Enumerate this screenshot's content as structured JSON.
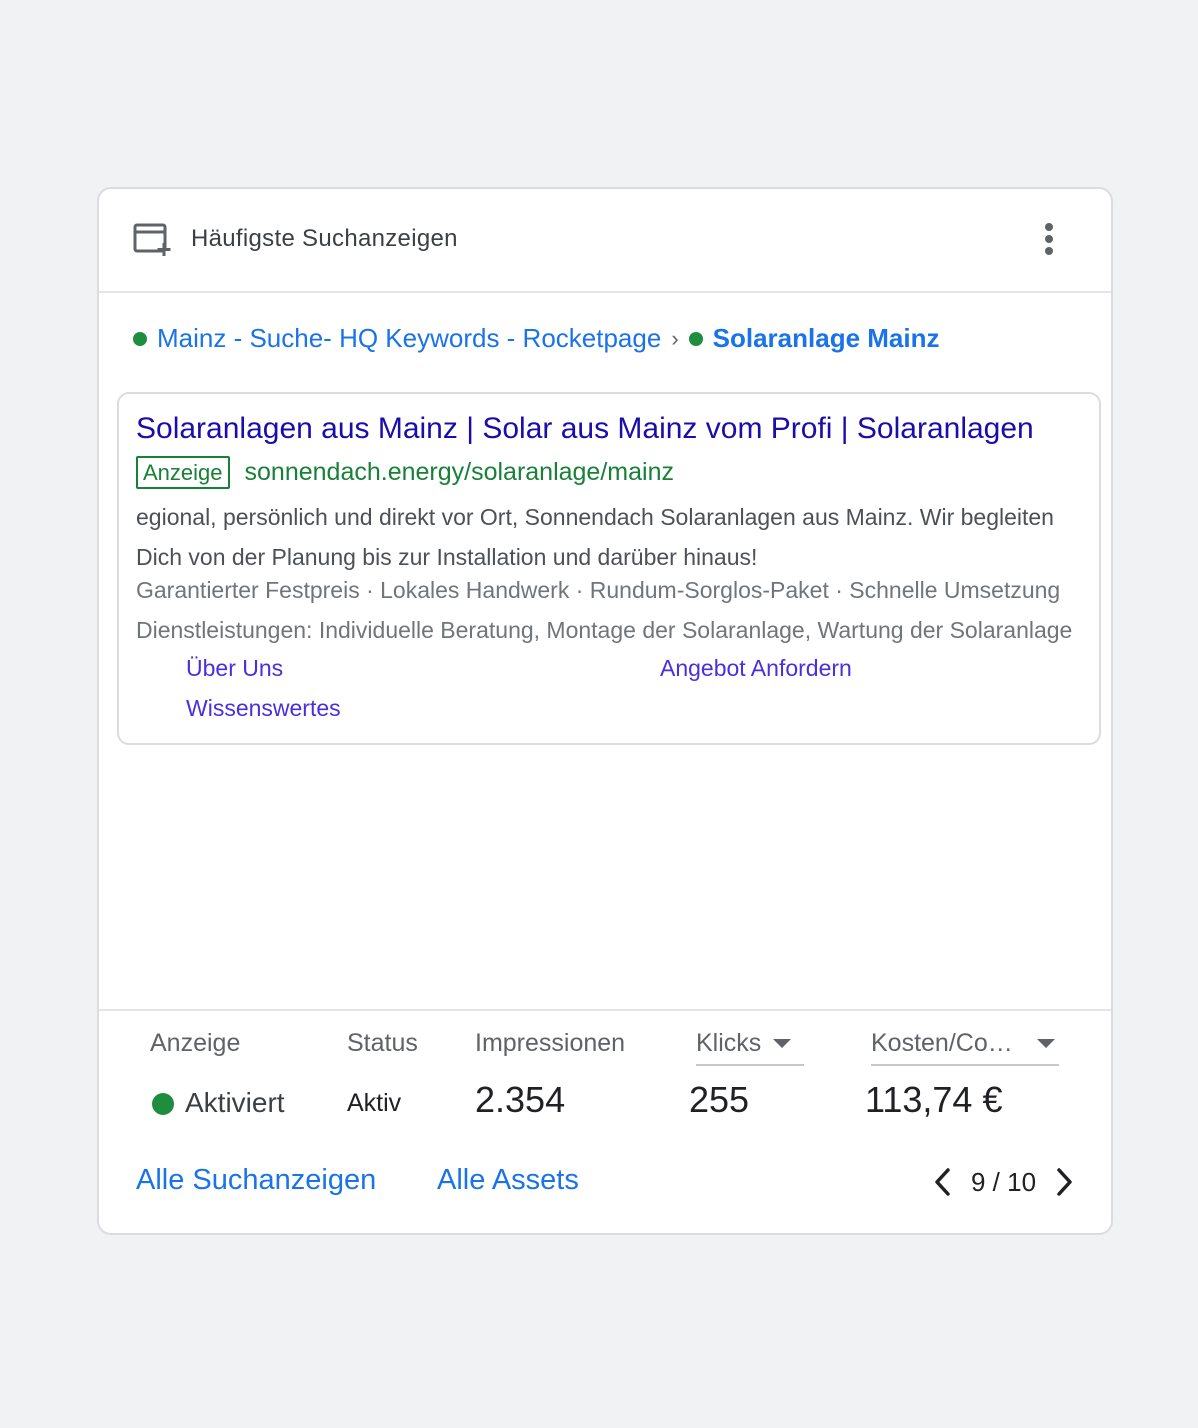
{
  "header": {
    "title": "Häufigste Suchanzeigen",
    "icon": "ad-panel-icon",
    "menu_icon": "more-vert-icon"
  },
  "breadcrumb": {
    "campaign": "Mainz - Suche- HQ Keywords - Rocketpage",
    "separator": "›",
    "ad_group": "Solaranlage Mainz",
    "status_color": "#1e8e3e"
  },
  "ad_preview": {
    "headline": "Solaranlagen aus Mainz | Solar aus Mainz vom Profi | Solaranlagen",
    "badge": "Anzeige",
    "display_url": "sonnendach.energy/solaranlage/mainz",
    "description": "egional, persönlich und direkt vor Ort, Sonnendach Solaranlagen aus Mainz. Wir begleiten Dich von der Planung bis zur Installation und darüber hinaus!",
    "callouts": "Garantierter Festpreis · Lokales Handwerk · Rundum-Sorglos-Paket · Schnelle Umsetzung",
    "structured_snippet": "Dienstleistungen: Individuelle Beratung, Montage der Solaranlage, Wartung der Solaranlage",
    "sitelinks": [
      "Über Uns",
      "Angebot Anfordern",
      "Wissenswertes"
    ]
  },
  "stats": {
    "columns": {
      "ad": "Anzeige",
      "status": "Status",
      "impressions": "Impressionen",
      "clicks": "Klicks",
      "cost": "Kosten/Co…"
    },
    "row": {
      "ad_state": "Aktiviert",
      "status": "Aktiv",
      "impressions": "2.354",
      "clicks": "255",
      "cost": "113,74 €"
    }
  },
  "footer": {
    "all_ads": "Alle Suchanzeigen",
    "all_assets": "Alle Assets",
    "pager": "9 / 10",
    "prev_icon": "chevron-left-icon",
    "next_icon": "chevron-right-icon"
  }
}
